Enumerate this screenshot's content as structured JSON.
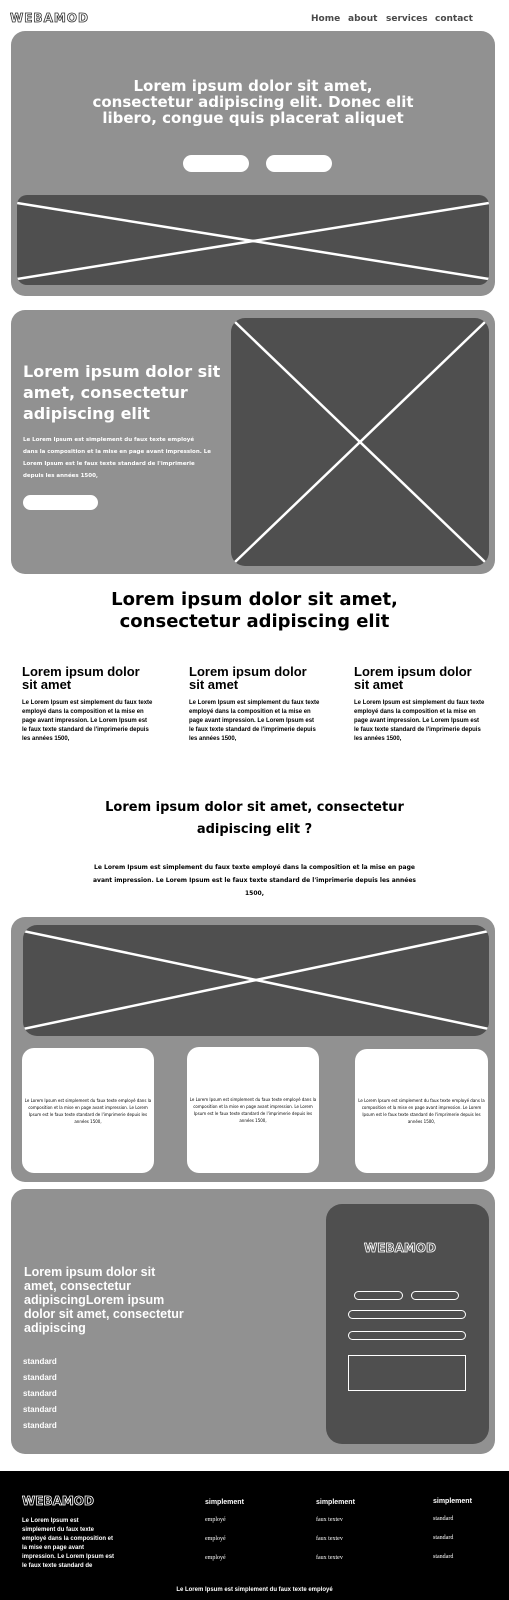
{
  "brand": {
    "logo_text": "WEBAMOD"
  },
  "nav": {
    "items": [
      "Home",
      "about",
      "services",
      "contact"
    ]
  },
  "hero": {
    "title_lines": [
      "Lorem ipsum dolor sit amet,",
      "consectetur adipiscing elit. Donec elit",
      "libero, congue quis placerat aliquet"
    ]
  },
  "feature": {
    "title_lines": [
      "Lorem ipsum dolor sit",
      "amet, consectetur",
      "adipiscing elit"
    ],
    "body_lines": [
      "Le Lorem Ipsum est simplement du faux texte employé",
      "dans la composition et la mise en page avant impression. Le",
      "Lorem Ipsum est le faux texte standard de l'imprimerie",
      "depuis les années 1500,"
    ]
  },
  "section_title": {
    "lines": [
      "Lorem ipsum dolor sit amet,",
      "consectetur adipiscing elit"
    ]
  },
  "columns": [
    {
      "title_lines": [
        "Lorem ipsum dolor",
        "sit amet"
      ],
      "body_lines": [
        "Le Lorem Ipsum est simplement du faux texte",
        "employé dans la composition et la mise en",
        "page avant impression. Le Lorem Ipsum est",
        "le faux texte standard de l'imprimerie depuis",
        "les années 1500,"
      ]
    },
    {
      "title_lines": [
        "Lorem ipsum dolor",
        "sit amet"
      ],
      "body_lines": [
        "Le Lorem Ipsum est simplement du faux texte",
        "employé dans la composition et la mise en",
        "page avant impression. Le Lorem Ipsum est",
        "le faux texte standard de l'imprimerie depuis",
        "les années 1500,"
      ]
    },
    {
      "title_lines": [
        "Lorem ipsum dolor",
        "sit amet"
      ],
      "body_lines": [
        "Le Lorem Ipsum est simplement du faux texte",
        "employé dans la composition et la mise en",
        "page avant impression. Le Lorem Ipsum est",
        "le faux texte standard de l'imprimerie depuis",
        "les années 1500,"
      ]
    }
  ],
  "question": {
    "title_lines": [
      "Lorem ipsum dolor sit amet, consectetur",
      "adipiscing elit ?"
    ],
    "body_lines": [
      "Le Lorem Ipsum est simplement du faux texte employé dans la composition et la mise en page",
      "avant impression. Le Lorem Ipsum est le faux texte standard de l'imprimerie depuis les années",
      "1500,"
    ]
  },
  "cards": [
    {
      "lines": [
        "Le Lorem Ipsum est simplement du faux texte employé dans la",
        "composition et la mise en page avant impression. Le Lorem",
        "Ipsum est le faux texte standard de l'imprimerie depuis les",
        "années 1500,"
      ]
    },
    {
      "lines": [
        "Le Lorem Ipsum est simplement du faux texte employé dans la",
        "composition et la mise en page avant impression. Le Lorem",
        "Ipsum est le faux texte standard de l'imprimerie depuis les",
        "années 1500,"
      ]
    },
    {
      "lines": [
        "Le Lorem Ipsum est simplement du faux texte employé dans la",
        "composition et la mise en page avant impression. Le Lorem",
        "Ipsum est le faux texte standard de l'imprimerie depuis les",
        "années 1500,"
      ]
    }
  ],
  "contact": {
    "title_lines": [
      "Lorem ipsum dolor sit",
      "amet, consectetur",
      "adipiscingLorem ipsum",
      "dolor sit amet, consectetur",
      "adipiscing"
    ],
    "list": [
      "standard",
      "standard",
      "standard",
      "standard",
      "standard"
    ]
  },
  "footer": {
    "about_lines": [
      "Le Lorem Ipsum est",
      "simplement du faux texte",
      "employé dans la composition et",
      "la mise en page avant",
      "impression. Le Lorem Ipsum est",
      "le faux texte standard de"
    ],
    "columns": [
      {
        "heading": "simplement",
        "items": [
          "employé",
          "employé",
          "employé"
        ]
      },
      {
        "heading": "simplement",
        "items": [
          "faux textev",
          "faux textev",
          "faux textev"
        ]
      },
      {
        "heading": "simplement",
        "items": [
          "standard",
          "standard",
          "standard"
        ]
      }
    ],
    "bottom_line": "Le Lorem Ipsum est simplement du faux texte employé"
  },
  "colors": {
    "panel": "#919191",
    "dark": "#4f4f4f",
    "footer": "#000000",
    "text": "#ffffff"
  }
}
